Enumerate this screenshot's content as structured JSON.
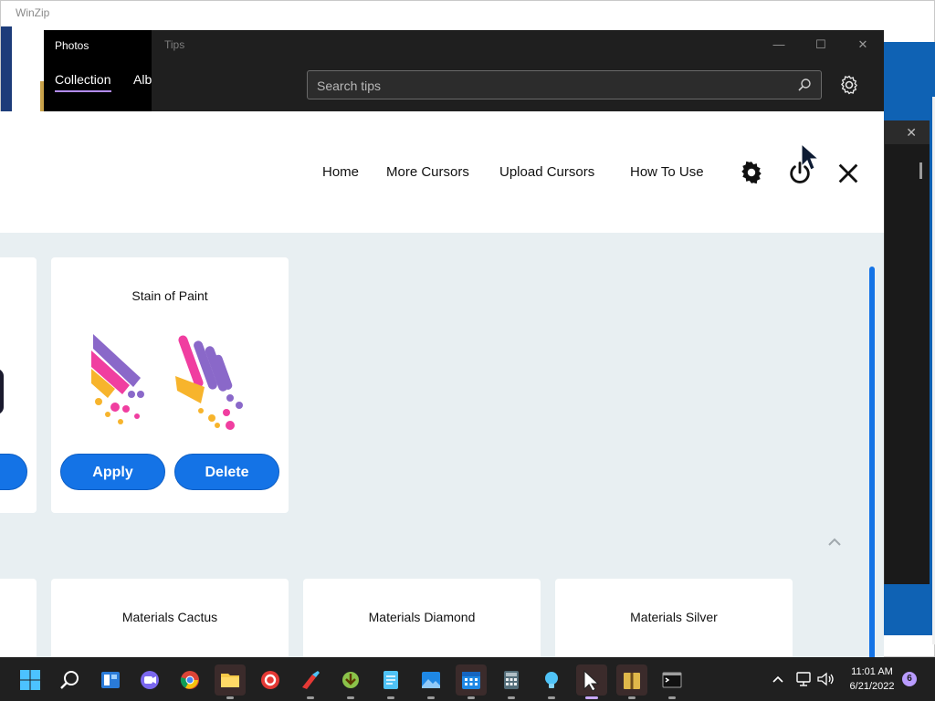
{
  "winzip": {
    "title": "WinZip"
  },
  "photos": {
    "title": "Photos",
    "tabs": [
      "Collection",
      "Albums"
    ]
  },
  "tips": {
    "title": "Tips",
    "search_placeholder": "Search tips"
  },
  "cursor_app": {
    "nav": [
      "Home",
      "More Cursors",
      "Upload Cursors",
      "How To Use"
    ],
    "cards": [
      {
        "title": "Stain of Paint",
        "buttons": [
          "Apply",
          "Delete"
        ]
      }
    ],
    "bottom_cards": [
      {
        "title": "Materials Cactus"
      },
      {
        "title": "Materials Diamond"
      },
      {
        "title": "Materials Silver"
      }
    ],
    "colors": {
      "accent": "#1473e6",
      "content_bg": "#e8eff2"
    }
  },
  "taskbar": {
    "time": "11:01 AM",
    "date": "6/21/2022",
    "notifications": "6",
    "apps": [
      "start",
      "search",
      "widgets",
      "teams",
      "chrome",
      "file-explorer",
      "ccleaner",
      "ccleaner-brush",
      "fdm",
      "notepad",
      "photos",
      "calendar",
      "calculator",
      "tips",
      "cursor-app",
      "winzip",
      "terminal"
    ]
  }
}
